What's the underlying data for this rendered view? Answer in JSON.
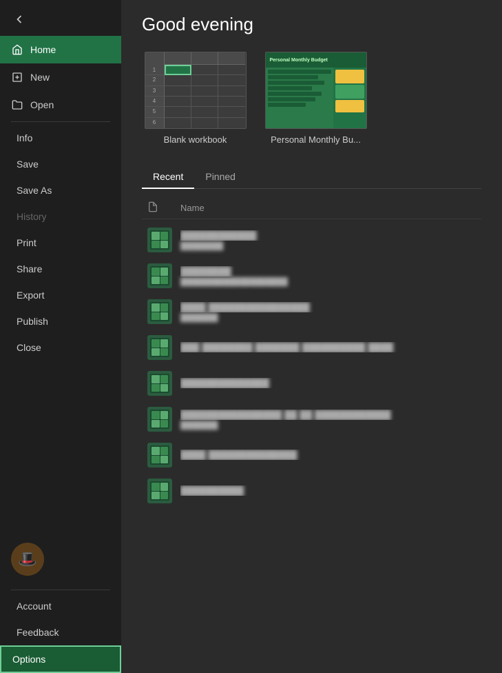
{
  "sidebar": {
    "back_label": "←",
    "items": [
      {
        "id": "home",
        "label": "Home",
        "icon": "home-icon",
        "active": true
      },
      {
        "id": "new",
        "label": "New",
        "icon": "new-icon"
      },
      {
        "id": "open",
        "label": "Open",
        "icon": "open-icon"
      }
    ],
    "menu_items": [
      {
        "id": "info",
        "label": "Info"
      },
      {
        "id": "save",
        "label": "Save"
      },
      {
        "id": "save-as",
        "label": "Save As"
      },
      {
        "id": "history",
        "label": "History",
        "disabled": true
      },
      {
        "id": "print",
        "label": "Print"
      },
      {
        "id": "share",
        "label": "Share"
      },
      {
        "id": "export",
        "label": "Export"
      },
      {
        "id": "publish",
        "label": "Publish"
      },
      {
        "id": "close",
        "label": "Close"
      }
    ],
    "bottom_items": [
      {
        "id": "account",
        "label": "Account"
      },
      {
        "id": "feedback",
        "label": "Feedback"
      },
      {
        "id": "options",
        "label": "Options",
        "highlighted": true
      }
    ]
  },
  "main": {
    "greeting": "Good evening",
    "templates": [
      {
        "id": "blank",
        "name": "Blank workbook"
      },
      {
        "id": "budget",
        "name": "Personal Monthly Bu..."
      }
    ],
    "tabs": [
      {
        "id": "recent",
        "label": "Recent",
        "active": true
      },
      {
        "id": "pinned",
        "label": "Pinned"
      }
    ],
    "files_header": {
      "name_col": "Name"
    },
    "files": [
      {
        "id": 1,
        "name": "████████",
        "meta": "████████"
      },
      {
        "id": 2,
        "name": "██████",
        "meta": "██████████████████"
      },
      {
        "id": 3,
        "name": "████ ████████████",
        "meta": "███████"
      },
      {
        "id": 4,
        "name": "████ ████████ ████████ ████",
        "meta": ""
      },
      {
        "id": 5,
        "name": "██████████",
        "meta": ""
      },
      {
        "id": 6,
        "name": "██████████████ ████ ██ ██████",
        "meta": "███████"
      },
      {
        "id": 7,
        "name": "████ ███████████",
        "meta": ""
      },
      {
        "id": 8,
        "name": "████████",
        "meta": ""
      }
    ]
  },
  "colors": {
    "sidebar_bg": "#1e1e1e",
    "active_green": "#217346",
    "highlight_border": "#6fcf97",
    "main_bg": "#2b2b2b",
    "text_primary": "#ffffff",
    "text_secondary": "#cccccc",
    "text_muted": "#888888"
  }
}
